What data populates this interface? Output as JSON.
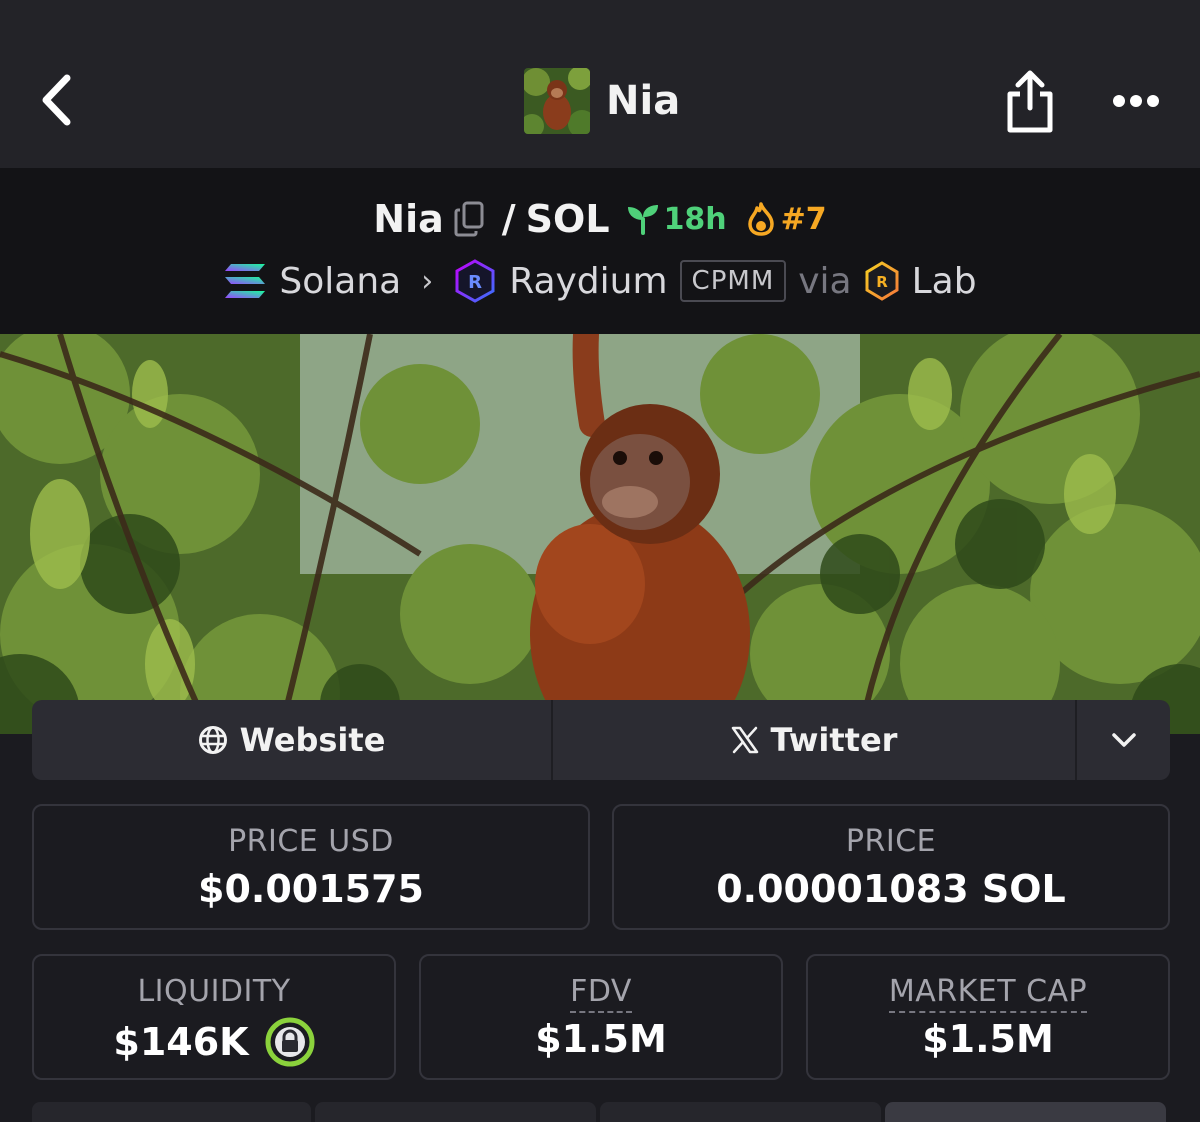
{
  "header": {
    "title": "Nia",
    "back_icon": "chevron-left-icon",
    "share_icon": "share-icon",
    "more_icon": "ellipsis-icon"
  },
  "pair": {
    "base": "Nia",
    "separator": "/",
    "quote": "SOL",
    "age": "18h",
    "rank": "#7",
    "age_color": "#4fd17a",
    "rank_color": "#f6a823"
  },
  "chain": {
    "network": "Solana",
    "dex": "Raydium",
    "pool_type": "CPMM",
    "via_label": "via",
    "launchpad": "Lab"
  },
  "links": {
    "website": "Website",
    "twitter": "Twitter"
  },
  "stats": {
    "price_usd_label": "PRICE USD",
    "price_usd": "$0.001575",
    "price_label": "PRICE",
    "price": "0.00001083 SOL",
    "liquidity_label": "LIQUIDITY",
    "liquidity": "$146K",
    "fdv_label": "FDV",
    "fdv": "$1.5M",
    "mcap_label": "MARKET CAP",
    "mcap": "$1.5M"
  }
}
